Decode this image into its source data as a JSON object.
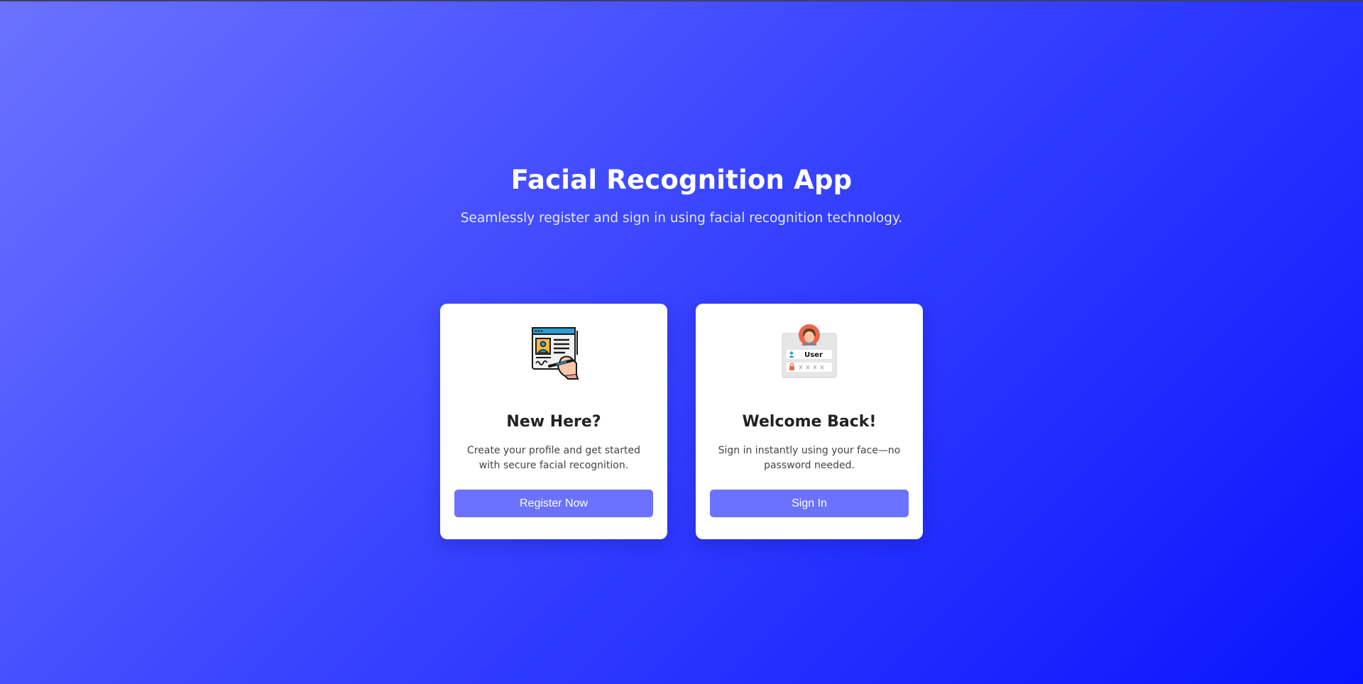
{
  "hero": {
    "title": "Facial Recognition App",
    "subtitle": "Seamlessly register and sign in using facial recognition technology."
  },
  "cards": [
    {
      "icon": "registration-form-icon",
      "heading": "New Here?",
      "description": "Create your profile and get started with secure facial recognition.",
      "button_label": "Register Now"
    },
    {
      "icon": "user-login-icon",
      "heading": "Welcome Back!",
      "description": "Sign in instantly using your face—no password needed.",
      "button_label": "Sign In",
      "icon_text": "User"
    }
  ],
  "colors": {
    "gradient_start": "#6b72ff",
    "gradient_end": "#0a14ff",
    "button": "#6b72ff",
    "card": "#ffffff"
  }
}
